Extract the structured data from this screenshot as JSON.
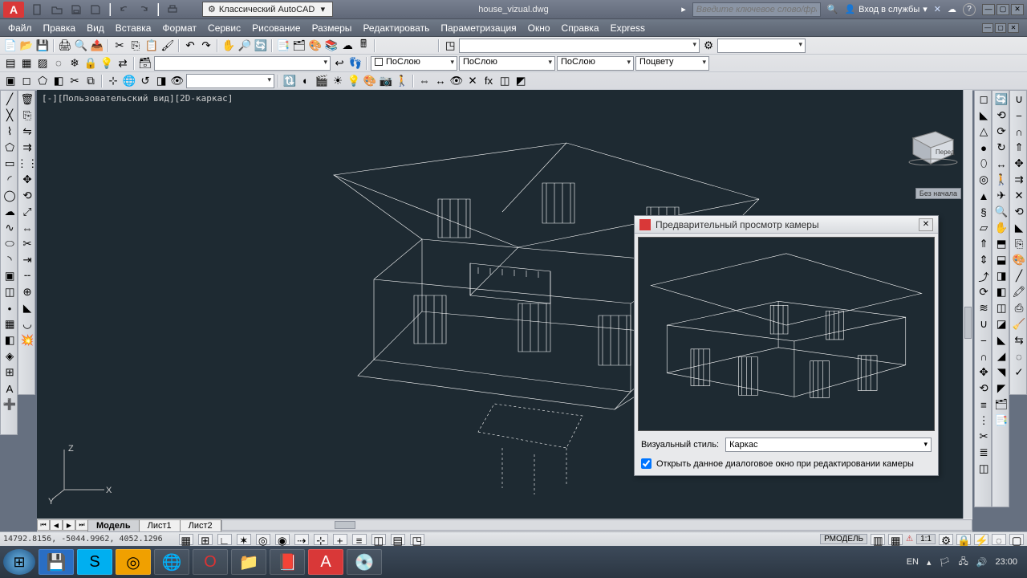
{
  "title": {
    "workspace_label": "Классический AutoCAD",
    "document": "house_vizual.dwg",
    "search_placeholder": "Введите ключевое слово/фразу",
    "signin_label": "Вход в службы"
  },
  "menu": {
    "file": "Файл",
    "edit": "Правка",
    "view": "Вид",
    "insert": "Вставка",
    "format": "Формат",
    "service": "Сервис",
    "drawing": "Рисование",
    "dimensions": "Размеры",
    "modify": "Редактировать",
    "parametrize": "Параметризация",
    "window": "Окно",
    "help": "Справка",
    "express": "Express"
  },
  "properties": {
    "color_label": "ПоСлою",
    "linetype_label": "ПоСлою",
    "lineweight_label": "ПоСлою",
    "plotstyle_label": "Поцвету"
  },
  "viewport": {
    "title": "[-][Пользовательский вид][2D-каркас]",
    "cube_face": "Перед",
    "no_selection": "Без начала",
    "axes": {
      "x": "X",
      "y": "Y",
      "z": "Z"
    }
  },
  "dialog": {
    "title": "Предварительный просмотр камеры",
    "style_label": "Визуальный стиль:",
    "style_value": "Каркас",
    "checkbox_label": "Открыть данное диалоговое окно при редактировании камеры",
    "checkbox_checked": true
  },
  "tabs": {
    "model": "Модель",
    "sheet1": "Лист1",
    "sheet2": "Лист2"
  },
  "status": {
    "coords": "14792.8156, -5044.9962, 4052.1296",
    "space_mode": "РМОДЕЛЬ",
    "scale": "1:1"
  },
  "tray": {
    "lang": "EN",
    "time": "23:00"
  }
}
